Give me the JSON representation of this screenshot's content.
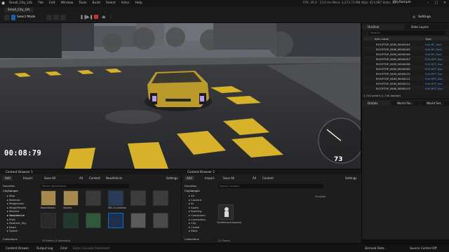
{
  "menubar": {
    "menus": [
      "Small_City_LVL",
      "File",
      "Edit",
      "Window",
      "Tools",
      "Build",
      "Select",
      "Actor",
      "Help"
    ],
    "stats": "FPS: 30.2 · 13.0 ms   Mem: 3,273.73 MB   Objs: 413,987   Stats: 15",
    "project": "CitySample"
  },
  "toolbar": {
    "tab_level": "Small_City_LVL",
    "select_mode": "Select Mode",
    "settings": "Settings"
  },
  "viewport": {
    "timer": "00:08:79",
    "speed": "73"
  },
  "outliner": {
    "tab": "Outliner",
    "tab2": "Data Layers",
    "search_placeholder": "Search...",
    "col_label": "Item Label",
    "col_type": "Type",
    "rows": [
      {
        "label": "ROOFTOP_BGM_M000004",
        "type": "Edit BP_Roof"
      },
      {
        "label": "ROOFTOP_BGM_M000005",
        "type": "Edit BP_Roof"
      },
      {
        "label": "ROOFTOP_BGM_M000006",
        "type": "Edit BP_Roof"
      },
      {
        "label": "ROOFTOP_BGM_M000007",
        "type": "Edit BPP_Roo"
      },
      {
        "label": "ROOFTOP_BGM_M000008",
        "type": "Edit BPP_Roo"
      },
      {
        "label": "ROOFTOP_BGM_M000009",
        "type": "Edit BPP_Roo"
      },
      {
        "label": "ROOFTOP_BGM_M000010",
        "type": "Edit BPP_Roo"
      },
      {
        "label": "ROOFTOP_BGM_M000011",
        "type": "Edit BPP_Roo"
      },
      {
        "label": "ROOFTOP_BGM_M000012",
        "type": "Edit BPP_Roo"
      },
      {
        "label": "ROOFTOP_BGM_M000013",
        "type": "Edit BPP_Roo"
      }
    ],
    "footer": "1,744 actors (1,744 loaded)"
  },
  "details": {
    "tab": "Details",
    "tab2": "World Par...",
    "tab3": "World Set..."
  },
  "content_browser_1": {
    "title": "Content Browser 1",
    "add": "Add",
    "import": "Import",
    "save_all": "Save All",
    "path": [
      "All",
      "Content",
      "NewVehicle"
    ],
    "settings": "Settings",
    "favorites": "Favorites",
    "project": "CitySample",
    "tree": [
      "Map",
      "Material",
      "Megascans",
      "MegaPresets",
      "Meshes",
      "NewVehicle",
      "Pred",
      "Realistic_Sky",
      "Road",
      "Splash"
    ],
    "search_placeholder": "Search NewVehicle",
    "tile_labels": [
      "Nearesttown",
      "Speedo",
      "",
      "WB_Countdown",
      "",
      "",
      "",
      "",
      "",
      "",
      "",
      ""
    ],
    "collections": "Collections",
    "status": "13 items (1 selected)"
  },
  "content_browser_2": {
    "title": "Content Browser 2",
    "add": "Add",
    "import": "Import",
    "save_all": "Save All",
    "path": [
      "All",
      "Content"
    ],
    "settings": "Settings",
    "favorites": "Favorites",
    "project": "CitySample",
    "tree": [
      "All",
      "Content",
      "Ai",
      "Audio",
      "Building",
      "Characters",
      "Cinematics",
      "City",
      "Crowd",
      "Data"
    ],
    "search_placeholder": "Search Content",
    "filter_label": "Template",
    "tile_label": "ThirdPersonCharacter",
    "collections": "Collections",
    "status": "27 items"
  },
  "statusbar": {
    "content_drawer": "Content Drawer",
    "output_log": "Output Log",
    "cmd": "Cmd",
    "cmd_placeholder": "Enter Console Command",
    "derived": "Derived Data",
    "source": "Source Control Off"
  },
  "colors": {
    "accent": "#0d6bd1",
    "timer": "#ffffff",
    "road_marking": "#d8b12a",
    "car": "#c9a92e"
  }
}
